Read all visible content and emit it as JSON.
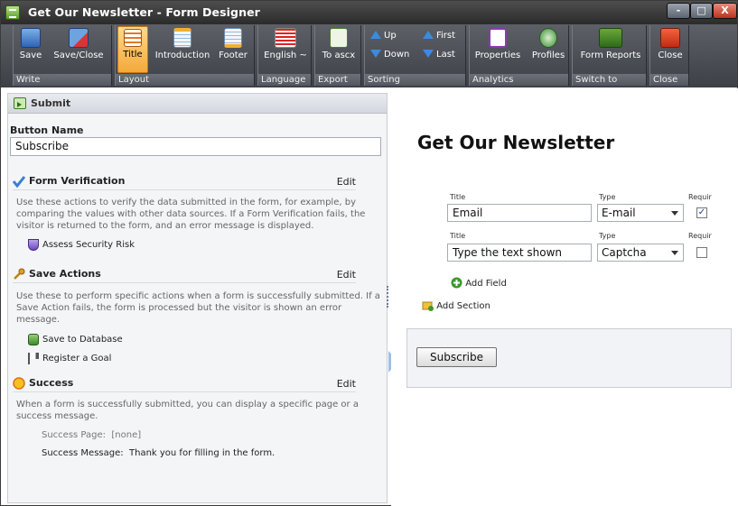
{
  "window": {
    "title": "Get Our Newsletter - Form Designer",
    "controls": {
      "minimize": "-",
      "maximize": "□",
      "close": "X"
    }
  },
  "ribbon": {
    "groups": [
      {
        "label": "Write",
        "buttons": [
          {
            "label": "Save",
            "icon": "save-icon"
          },
          {
            "label": "Save/Close",
            "icon": "save-close-icon"
          }
        ]
      },
      {
        "label": "Layout",
        "buttons": [
          {
            "label": "Title",
            "icon": "title-layout-icon",
            "active": true
          },
          {
            "label": "Introduction",
            "icon": "introduction-layout-icon"
          },
          {
            "label": "Footer",
            "icon": "footer-layout-icon"
          }
        ]
      },
      {
        "label": "Language",
        "buttons": [
          {
            "label": "English ~",
            "icon": "us-flag-icon"
          }
        ]
      },
      {
        "label": "Export",
        "buttons": [
          {
            "label": "To ascx",
            "icon": "csharp-file-icon"
          }
        ]
      },
      {
        "label": "Sorting",
        "buttons": [
          {
            "label": "Up",
            "icon": "arrow-up-icon"
          },
          {
            "label": "Down",
            "icon": "arrow-down-icon"
          },
          {
            "label": "First",
            "icon": "double-arrow-up-icon"
          },
          {
            "label": "Last",
            "icon": "double-arrow-down-icon"
          }
        ]
      },
      {
        "label": "Analytics",
        "buttons": [
          {
            "label": "Properties",
            "icon": "properties-icon"
          },
          {
            "label": "Profiles",
            "icon": "profiles-icon"
          }
        ]
      },
      {
        "label": "Switch to",
        "buttons": [
          {
            "label": "Form Reports",
            "icon": "form-reports-icon"
          }
        ]
      },
      {
        "label": "Close",
        "buttons": [
          {
            "label": "Close",
            "icon": "close-red-icon"
          }
        ]
      }
    ]
  },
  "left_panel": {
    "header": "Submit",
    "button_name_label": "Button Name",
    "button_name_value": "Subscribe",
    "form_verification": {
      "title": "Form Verification",
      "edit": "Edit",
      "description": "Use these actions to verify the data submitted in the form, for example, by comparing the values with other data sources. If a Form Verification fails, the visitor is returned to the form, and an error message is displayed.",
      "actions": [
        "Assess Security Risk"
      ]
    },
    "save_actions": {
      "title": "Save Actions",
      "edit": "Edit",
      "description": "Use these to perform specific actions when a form is successfully submitted. If a Save Action fails, the form is processed but the visitor is shown an error message.",
      "actions": [
        "Save to Database",
        "Register a Goal"
      ]
    },
    "success": {
      "title": "Success",
      "edit": "Edit",
      "description": "When a form is successfully submitted, you can display a specific page or a success message.",
      "page_label": "Success Page:",
      "page_value": "[none]",
      "message_label": "Success Message:",
      "message_value": "Thank you for filling in the form."
    }
  },
  "form_preview": {
    "title": "Get Our Newsletter",
    "fields": [
      {
        "title_label": "Title",
        "title_value": "Email",
        "type_label": "Type",
        "type_value": "E-mail",
        "required_label": "Requir",
        "required": true
      },
      {
        "title_label": "Title",
        "title_value": "Type the text shown",
        "type_label": "Type",
        "type_value": "Captcha",
        "required_label": "Requir",
        "required": false
      }
    ],
    "add_field": "Add Field",
    "add_section": "Add Section",
    "submit_button": "Subscribe",
    "checkmark": "✓"
  }
}
